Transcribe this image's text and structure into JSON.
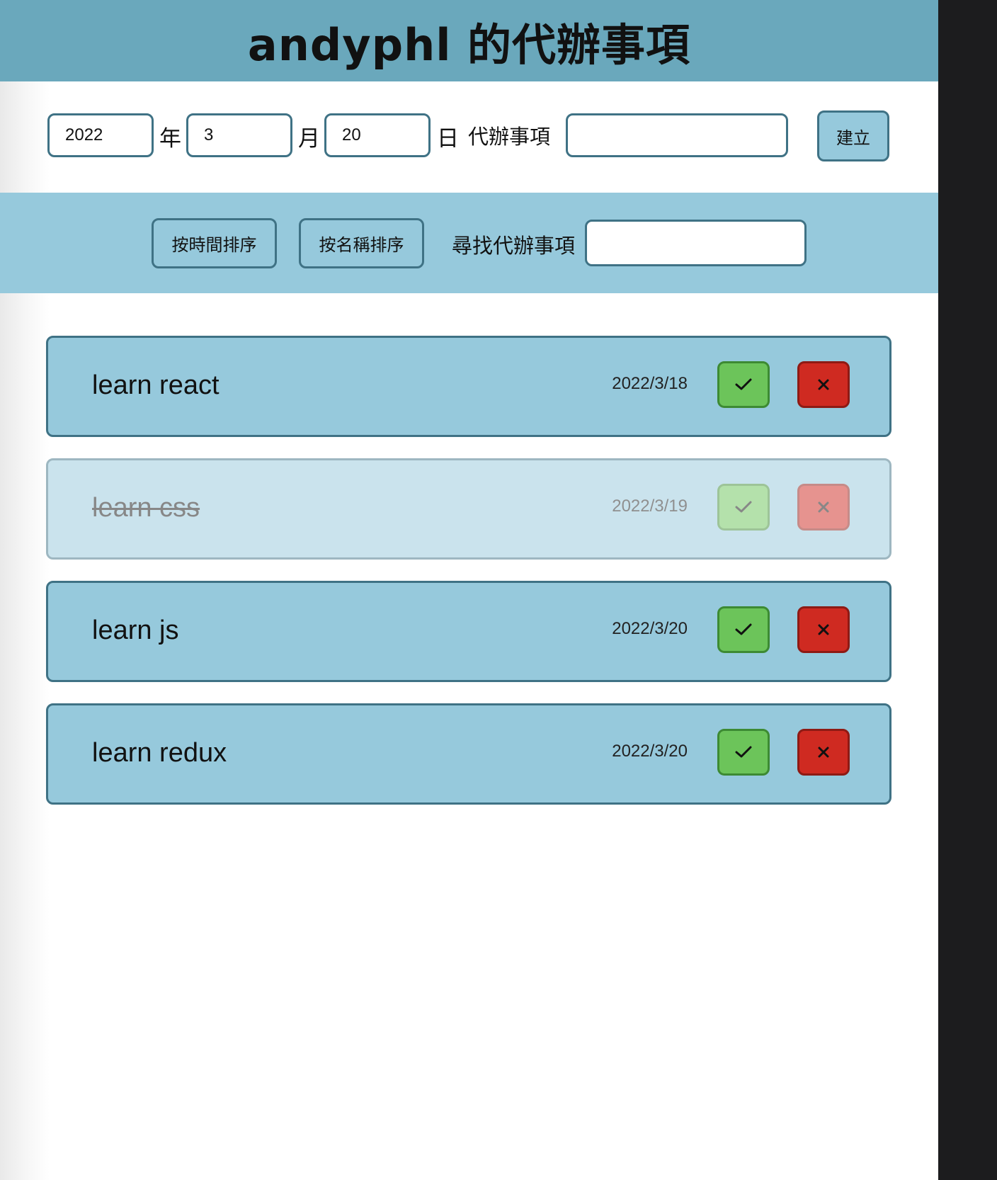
{
  "header": {
    "title": "andyphl 的代辦事項"
  },
  "create_form": {
    "year_value": "2022",
    "year_unit": "年",
    "month_value": "3",
    "month_unit": "月",
    "day_value": "20",
    "day_unit": "日",
    "todo_label": "代辦事項",
    "todo_value": "",
    "create_button_label": "建立"
  },
  "toolbar": {
    "sort_by_time_label": "按時間排序",
    "sort_by_name_label": "按名稱排序",
    "search_label": "尋找代辦事項",
    "search_value": ""
  },
  "todos": [
    {
      "text": "learn react",
      "date": "2022/3/18",
      "done": false
    },
    {
      "text": "learn css",
      "date": "2022/3/19",
      "done": true
    },
    {
      "text": "learn js",
      "date": "2022/3/20",
      "done": false
    },
    {
      "text": "learn redux",
      "date": "2022/3/20",
      "done": false
    }
  ],
  "icons": {
    "done": "check-icon",
    "delete": "close-icon"
  },
  "colors": {
    "header_bg": "#6aa8bc",
    "panel_bg": "#96c9dc",
    "border": "#3f7285",
    "done_button": "#6cc45a",
    "delete_button": "#cf2a21"
  }
}
